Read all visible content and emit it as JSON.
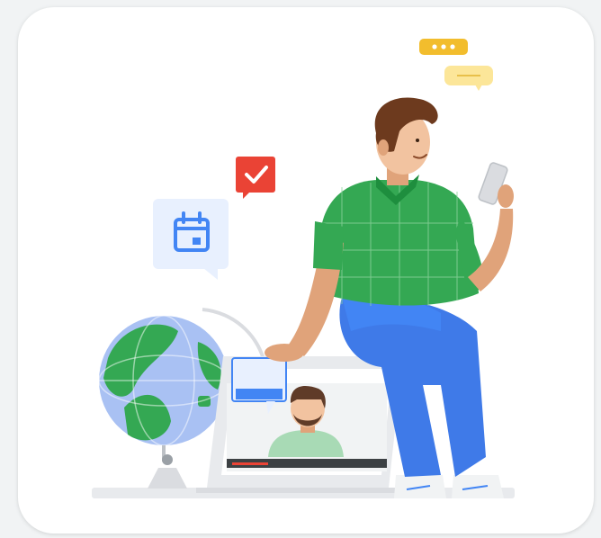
{
  "illustration": {
    "elements": [
      {
        "name": "chat-bubble-typing-icon",
        "color": "#f2bd2d"
      },
      {
        "name": "chat-bubble-message-icon",
        "color": "#fce699"
      },
      {
        "name": "checkmark-bubble-icon",
        "color": "#ea4335"
      },
      {
        "name": "calendar-icon",
        "color": "#4285f4"
      },
      {
        "name": "globe",
        "colors": [
          "#a9c1f3",
          "#34a853"
        ]
      },
      {
        "name": "laptop-video-call",
        "color": "#e8eaed"
      },
      {
        "name": "person-sitting-with-phone",
        "shirt_color": "#34a853",
        "pants_color": "#3f7ae8"
      }
    ]
  }
}
